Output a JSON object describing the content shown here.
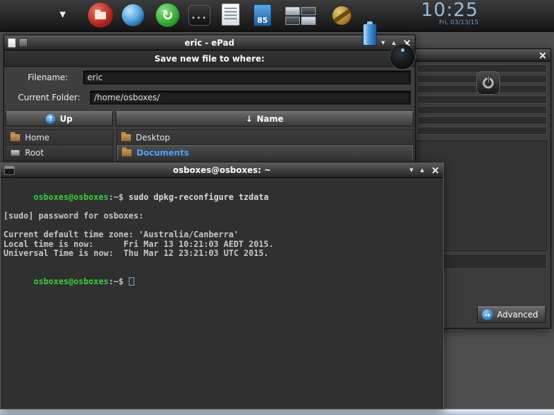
{
  "taskbar": {
    "clock_time": "10:25",
    "clock_date": "Fri, 03/13/15",
    "battery_label": "85",
    "keypad_dots": "•••"
  },
  "icons": {
    "taskbar_chevron": "▾",
    "refresh": "↻",
    "up_arrow": "↑",
    "sort_down": "↓",
    "advanced_arrow": "→",
    "shade": "▾",
    "unshade": "▴",
    "close": "×"
  },
  "epad": {
    "title": "eric - ePad",
    "header": "Save new file to where:",
    "filename_label": "Filename:",
    "filename_value": "eric",
    "folder_label": "Current Folder:",
    "folder_value": "/home/osboxes/",
    "up_button": "Up",
    "sort_button": "Name",
    "places": [
      {
        "label": "Home"
      },
      {
        "label": "Root"
      }
    ],
    "files": [
      {
        "label": "Desktop"
      },
      {
        "label": "Documents"
      }
    ]
  },
  "settings": {
    "advanced_button": "Advanced"
  },
  "terminal": {
    "title": "osboxes@osboxes: ~",
    "prompt": "osboxes@osboxes",
    "prompt_suffix": ":~$ ",
    "command": "sudo dpkg-reconfigure tzdata",
    "line_password": "[sudo] password for osboxes:",
    "line_tz": "Current default time zone: 'Australia/Canberra'",
    "line_local": "Local time is now:      Fri Mar 13 10:21:03 AEDT 2015.",
    "line_utc": "Universal Time is now:  Thu Mar 12 23:21:03 UTC 2015."
  }
}
